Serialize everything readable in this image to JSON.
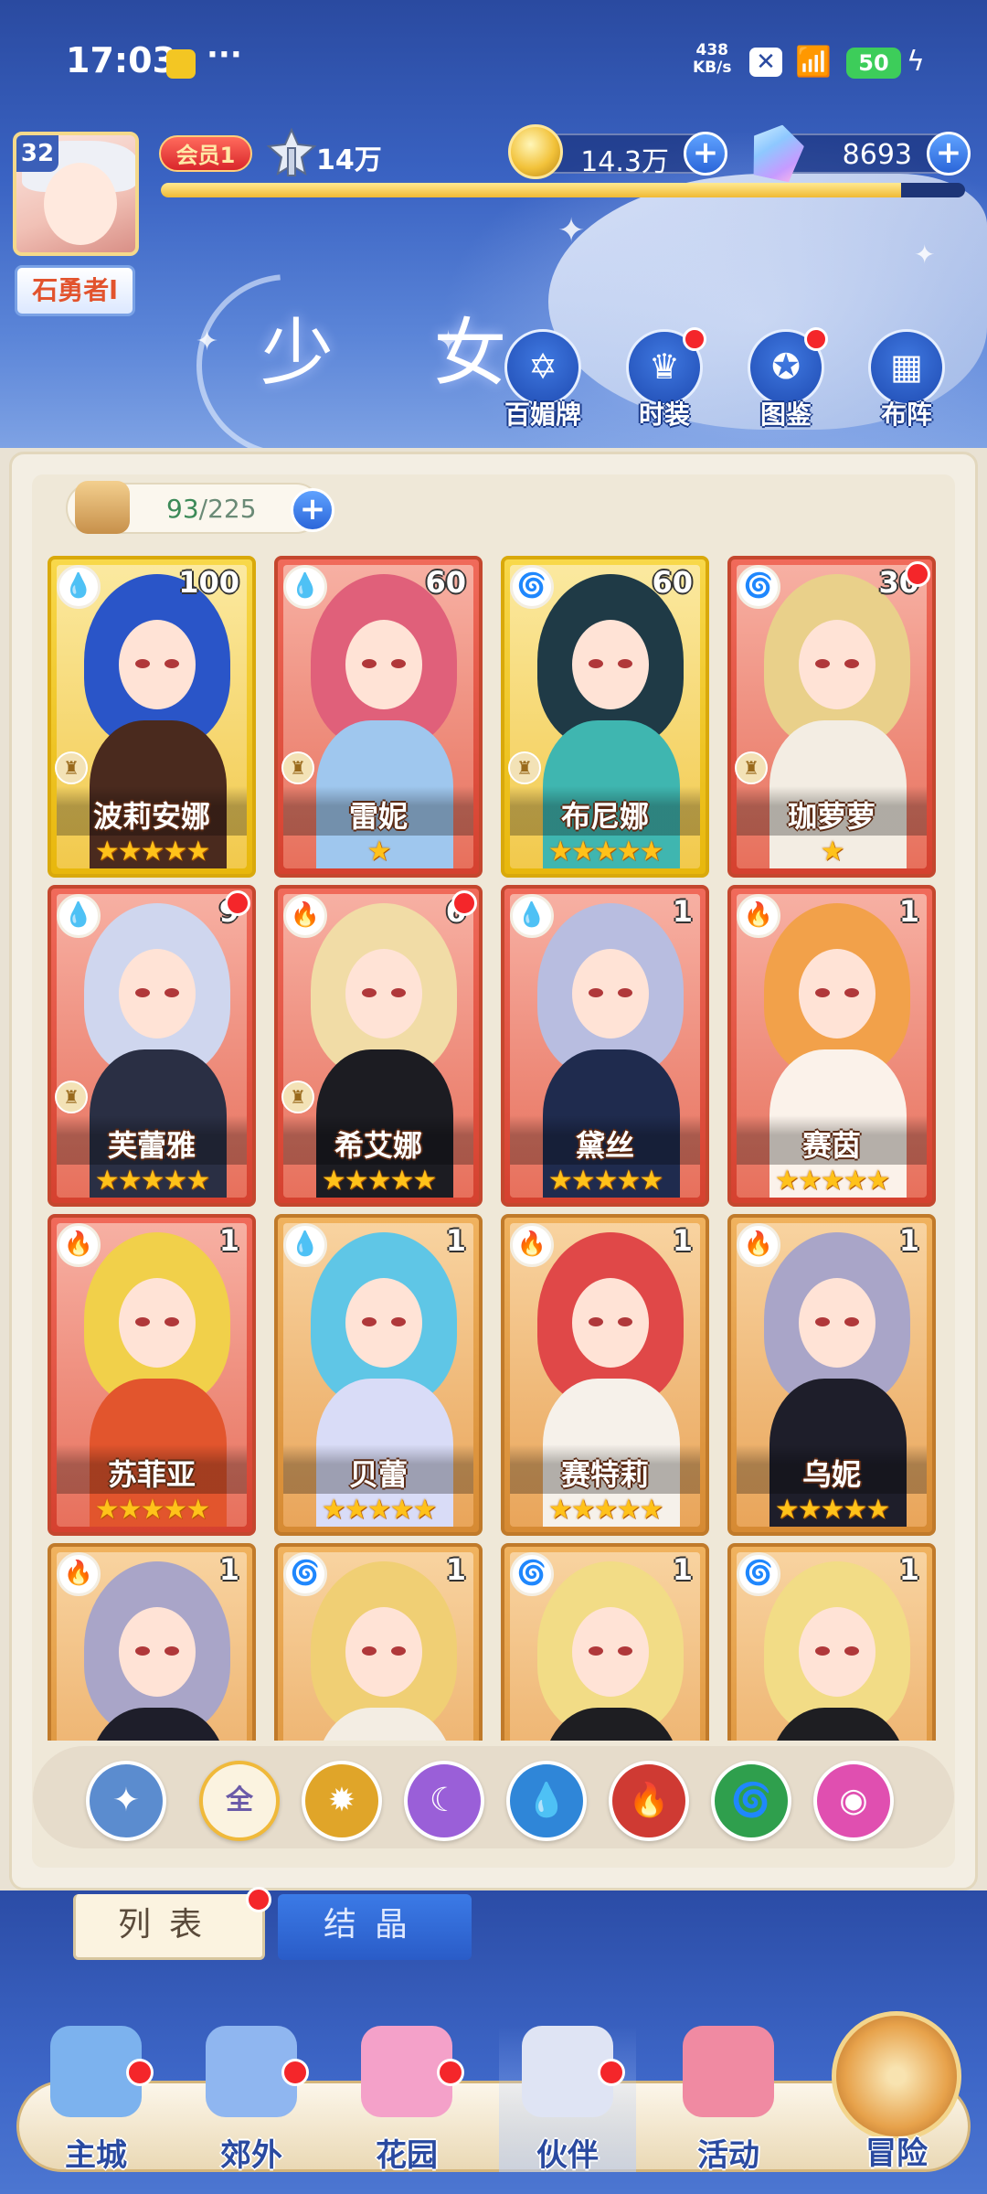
{
  "status_bar": {
    "time": "17:03",
    "more": "···",
    "net_speed_value": "438",
    "net_speed_unit": "KB/s",
    "battery": "50"
  },
  "player": {
    "level": "32",
    "name": "石勇者l",
    "vip_label": "会员1",
    "power": "14万",
    "exp_progress": 0.92
  },
  "resources": {
    "gold": "14.3万",
    "gems": "8693"
  },
  "page_title": "少 女",
  "functions": [
    {
      "label": "百媚牌",
      "icon": "card-icon",
      "badge": false
    },
    {
      "label": "时装",
      "icon": "outfit-icon",
      "badge": true
    },
    {
      "label": "图鉴",
      "icon": "book-icon",
      "badge": true
    },
    {
      "label": "布阵",
      "icon": "grid-icon",
      "badge": false
    }
  ],
  "capacity": {
    "current": "93",
    "max": "/225"
  },
  "cards": [
    {
      "name": "波莉安娜",
      "level": "100",
      "element": "water",
      "rarity": "gold",
      "stars": "★★★★★",
      "badge": false,
      "rank_icon": true,
      "hair": "#2a55c8",
      "outfit": "#4a2a1e"
    },
    {
      "name": "雷妮",
      "level": "60",
      "element": "water",
      "rarity": "red",
      "stars": "★",
      "badge": false,
      "rank_icon": true,
      "hair": "#e0607a",
      "outfit": "#9fc7ee"
    },
    {
      "name": "布尼娜",
      "level": "60",
      "element": "wind",
      "rarity": "gold",
      "stars": "★★★★★",
      "badge": false,
      "rank_icon": true,
      "hair": "#1f3a46",
      "outfit": "#3fb6b0"
    },
    {
      "name": "珈萝萝",
      "level": "30",
      "element": "wind",
      "rarity": "red",
      "stars": "★",
      "badge": true,
      "rank_icon": true,
      "hair": "#e9d08a",
      "outfit": "#f3ede3"
    },
    {
      "name": "芙蕾雅",
      "level": "9",
      "element": "water",
      "rarity": "red",
      "stars": "★★★★★",
      "badge": true,
      "rank_icon": true,
      "hair": "#cfd6ee",
      "outfit": "#2a2f44"
    },
    {
      "name": "希艾娜",
      "level": "6",
      "element": "fire",
      "rarity": "red",
      "stars": "★★★★★",
      "badge": true,
      "rank_icon": true,
      "hair": "#f1dca6",
      "outfit": "#1c1c22"
    },
    {
      "name": "黛丝",
      "level": "1",
      "element": "water",
      "rarity": "red",
      "stars": "★★★★★",
      "badge": false,
      "rank_icon": false,
      "hair": "#b8bde0",
      "outfit": "#1f2b4e"
    },
    {
      "name": "赛茵",
      "level": "1",
      "element": "fire",
      "rarity": "red",
      "stars": "★★★★★",
      "badge": false,
      "rank_icon": false,
      "hair": "#f2a14a",
      "outfit": "#fbf2ea"
    },
    {
      "name": "苏菲亚",
      "level": "1",
      "element": "fire",
      "rarity": "red",
      "stars": "★★★★★",
      "badge": false,
      "rank_icon": false,
      "hair": "#f1d04a",
      "outfit": "#e2552d"
    },
    {
      "name": "贝蕾",
      "level": "1",
      "element": "water",
      "rarity": "orange",
      "stars": "★★★★★",
      "badge": false,
      "rank_icon": false,
      "hair": "#5fc6e6",
      "outfit": "#d9dcf7"
    },
    {
      "name": "赛特莉",
      "level": "1",
      "element": "fire",
      "rarity": "orange",
      "stars": "★★★★★",
      "badge": false,
      "rank_icon": false,
      "hair": "#e04848",
      "outfit": "#f6f1ea"
    },
    {
      "name": "乌妮",
      "level": "1",
      "element": "fire",
      "rarity": "orange",
      "stars": "★★★★★",
      "badge": false,
      "rank_icon": false,
      "hair": "#a9a5c8",
      "outfit": "#1e1e2a"
    },
    {
      "name": "",
      "level": "1",
      "element": "fire",
      "rarity": "orange",
      "stars": "",
      "badge": false,
      "rank_icon": false,
      "hair": "#a9a5c8",
      "outfit": "#1e1e2a"
    },
    {
      "name": "",
      "level": "1",
      "element": "wind",
      "rarity": "orange",
      "stars": "",
      "badge": false,
      "rank_icon": false,
      "hair": "#f0cf74",
      "outfit": "#f3ede3"
    },
    {
      "name": "",
      "level": "1",
      "element": "wind",
      "rarity": "orange",
      "stars": "",
      "badge": false,
      "rank_icon": false,
      "hair": "#f2dc86",
      "outfit": "#1e1e22"
    },
    {
      "name": "",
      "level": "1",
      "element": "wind",
      "rarity": "orange",
      "stars": "",
      "badge": false,
      "rank_icon": false,
      "hair": "#f2dc86",
      "outfit": "#1e1e22"
    }
  ],
  "element_colors": {
    "water": "#2f86d8",
    "fire": "#cf3a33",
    "wind": "#2f9f4d"
  },
  "filters": [
    {
      "name": "filter-collapse",
      "label": "✦",
      "color": "#5b8ccf"
    },
    {
      "name": "filter-all",
      "label": "全",
      "color": "#fbf3e0"
    },
    {
      "name": "filter-light",
      "label": "✹",
      "color": "#e0a529"
    },
    {
      "name": "filter-dark",
      "label": "☾",
      "color": "#9a5fd8"
    },
    {
      "name": "filter-water",
      "label": "💧",
      "color": "#2f86d8"
    },
    {
      "name": "filter-fire",
      "label": "🔥",
      "color": "#cf3a33"
    },
    {
      "name": "filter-wind",
      "label": "🌀",
      "color": "#2f9f4d"
    },
    {
      "name": "filter-spirit",
      "label": "◉",
      "color": "#e04fb0"
    }
  ],
  "tabs": {
    "list": "列表",
    "crystal": "结晶"
  },
  "nav": [
    {
      "label": "主城",
      "badge": true,
      "color": "#7cb2ee"
    },
    {
      "label": "郊外",
      "badge": true,
      "color": "#8fb6f0"
    },
    {
      "label": "花园",
      "badge": true,
      "color": "#f4a1c9"
    },
    {
      "label": "伙伴",
      "badge": true,
      "color": "#dfe4f4"
    },
    {
      "label": "活动",
      "badge": false,
      "color": "#f08aa2"
    }
  ],
  "adventure": "冒险"
}
